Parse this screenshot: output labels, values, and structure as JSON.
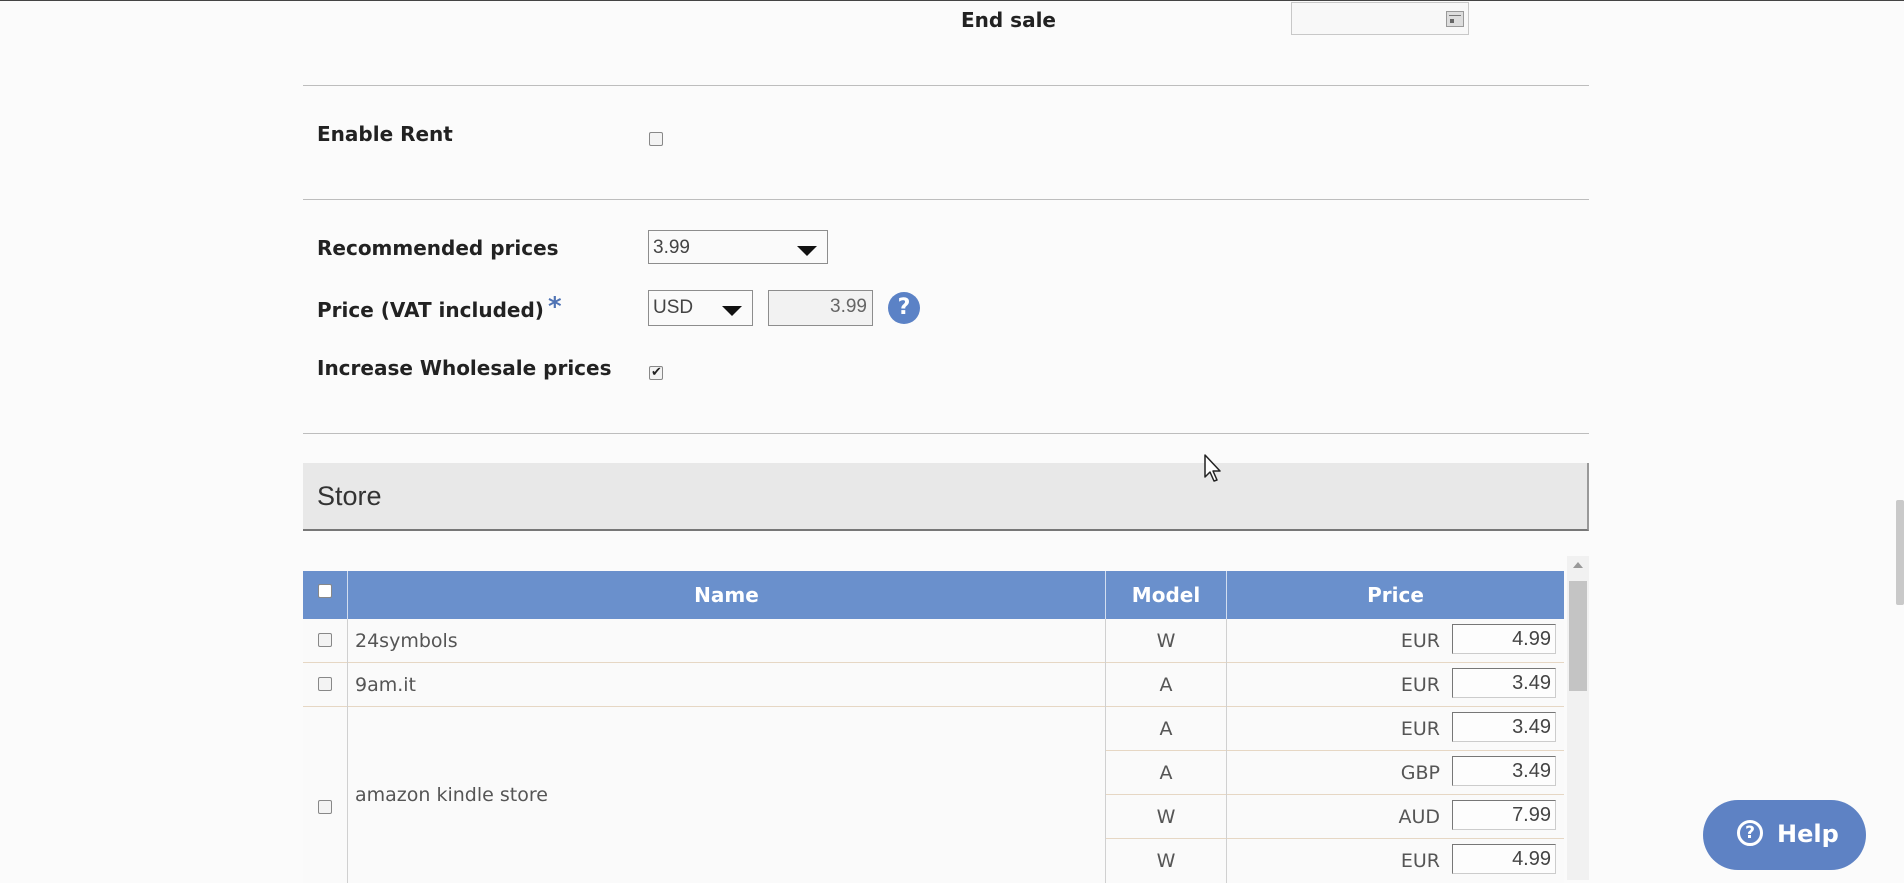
{
  "form": {
    "end_sale_label": "End sale",
    "end_sale_value": "",
    "enable_rent_label": "Enable Rent",
    "enable_rent_checked": false,
    "recommended_prices_label": "Recommended prices",
    "recommended_prices_value": "3.99",
    "price_label": "Price (VAT included)",
    "required_mark": "*",
    "currency_value": "USD",
    "price_value": "3.99",
    "help_icon_glyph": "?",
    "increase_wholesale_label": "Increase Wholesale prices",
    "increase_wholesale_checked": true
  },
  "store": {
    "title": "Store",
    "columns": {
      "name": "Name",
      "model": "Model",
      "price": "Price"
    },
    "rows": [
      {
        "name": "24symbols",
        "entries": [
          {
            "model": "W",
            "currency": "EUR",
            "price": "4.99"
          }
        ]
      },
      {
        "name": "9am.it",
        "entries": [
          {
            "model": "A",
            "currency": "EUR",
            "price": "3.49"
          }
        ]
      },
      {
        "name": "amazon kindle store",
        "entries": [
          {
            "model": "A",
            "currency": "EUR",
            "price": "3.49"
          },
          {
            "model": "A",
            "currency": "GBP",
            "price": "3.49"
          },
          {
            "model": "W",
            "currency": "AUD",
            "price": "7.99"
          },
          {
            "model": "W",
            "currency": "EUR",
            "price": "4.99"
          }
        ]
      }
    ]
  },
  "help_button": {
    "label": "Help",
    "icon_glyph": "?"
  },
  "colors": {
    "table_header": "#6a90cc",
    "accent": "#5e82c4"
  },
  "icons": {
    "calendar": "calendar-icon",
    "help": "help-circle-icon",
    "dropdown": "chevron-down-icon"
  }
}
